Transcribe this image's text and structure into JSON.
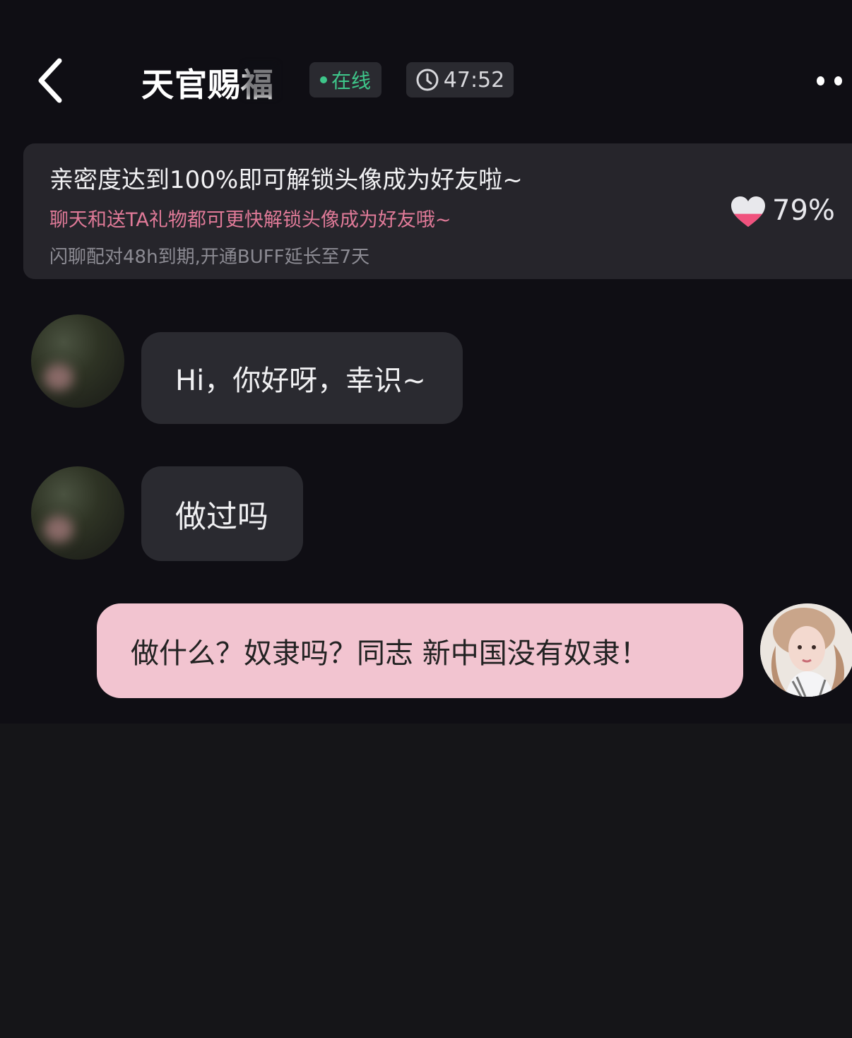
{
  "header": {
    "back_icon": "chevron-left-icon",
    "title": "天官赐福",
    "online_label": "在线",
    "timer_icon": "clock-icon",
    "timer": "47:52",
    "more_icon": "more-dots-icon"
  },
  "intimacy": {
    "headline": "亲密度达到100%即可解锁头像成为好友啦~",
    "hint": "聊天和送TA礼物都可更快解锁头像成为好友哦~",
    "notice": "闪聊配对48h到期,开通BUFF延长至7天",
    "heart_icon": "heart-icon",
    "percent": "79%",
    "level": 0.79
  },
  "messages": [
    {
      "sender": "other",
      "text": "Hi，你好呀，幸识~"
    },
    {
      "sender": "other",
      "text": "做过吗"
    },
    {
      "sender": "me",
      "text": "做什么？奴隶吗？同志 新中国没有奴隶！"
    }
  ],
  "colors": {
    "background": "#0f0e14",
    "card": "#26252b",
    "online": "#3ec68a",
    "hint_pink": "#e07a98",
    "my_bubble": "#f2c4d0"
  }
}
